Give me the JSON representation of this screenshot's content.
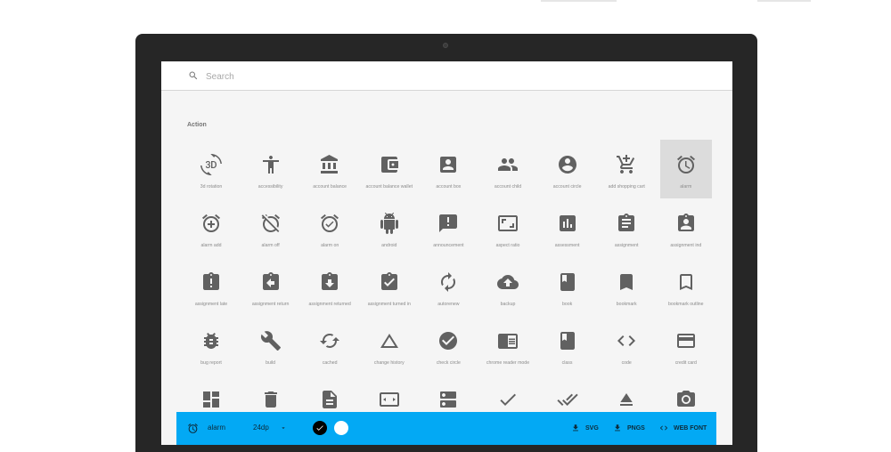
{
  "search": {
    "placeholder": "Search"
  },
  "section": {
    "title": "Action"
  },
  "icons": [
    {
      "label": "3d rotation",
      "icon": "3d-rotation-icon"
    },
    {
      "label": "accessibility",
      "icon": "accessibility-icon"
    },
    {
      "label": "account balance",
      "icon": "account-balance-icon"
    },
    {
      "label": "account balance wallet",
      "icon": "account-balance-wallet-icon"
    },
    {
      "label": "account box",
      "icon": "account-box-icon"
    },
    {
      "label": "account child",
      "icon": "account-child-icon"
    },
    {
      "label": "account circle",
      "icon": "account-circle-icon"
    },
    {
      "label": "add shopping cart",
      "icon": "add-shopping-cart-icon"
    },
    {
      "label": "alarm",
      "icon": "alarm-icon",
      "selected": true
    },
    {
      "label": "alarm add",
      "icon": "alarm-add-icon"
    },
    {
      "label": "alarm off",
      "icon": "alarm-off-icon"
    },
    {
      "label": "alarm on",
      "icon": "alarm-on-icon"
    },
    {
      "label": "android",
      "icon": "android-icon"
    },
    {
      "label": "announcement",
      "icon": "announcement-icon"
    },
    {
      "label": "aspect ratio",
      "icon": "aspect-ratio-icon"
    },
    {
      "label": "assessment",
      "icon": "assessment-icon"
    },
    {
      "label": "assignment",
      "icon": "assignment-icon"
    },
    {
      "label": "assignment ind",
      "icon": "assignment-ind-icon"
    },
    {
      "label": "assignment late",
      "icon": "assignment-late-icon"
    },
    {
      "label": "assignment return",
      "icon": "assignment-return-icon"
    },
    {
      "label": "assignment returned",
      "icon": "assignment-returned-icon"
    },
    {
      "label": "assignment turned in",
      "icon": "assignment-turned-in-icon"
    },
    {
      "label": "autorenew",
      "icon": "autorenew-icon"
    },
    {
      "label": "backup",
      "icon": "backup-icon"
    },
    {
      "label": "book",
      "icon": "book-icon"
    },
    {
      "label": "bookmark",
      "icon": "bookmark-icon"
    },
    {
      "label": "bookmark outline",
      "icon": "bookmark-outline-icon"
    },
    {
      "label": "bug report",
      "icon": "bug-report-icon"
    },
    {
      "label": "build",
      "icon": "build-icon"
    },
    {
      "label": "cached",
      "icon": "cached-icon"
    },
    {
      "label": "change history",
      "icon": "change-history-icon"
    },
    {
      "label": "check circle",
      "icon": "check-circle-icon"
    },
    {
      "label": "chrome reader mode",
      "icon": "chrome-reader-mode-icon"
    },
    {
      "label": "class",
      "icon": "class-icon"
    },
    {
      "label": "code",
      "icon": "code-icon"
    },
    {
      "label": "credit card",
      "icon": "credit-card-icon"
    },
    {
      "label": "",
      "icon": "dashboard-icon"
    },
    {
      "label": "",
      "icon": "delete-icon"
    },
    {
      "label": "",
      "icon": "description-icon"
    },
    {
      "label": "",
      "icon": "dns-icon"
    },
    {
      "label": "",
      "icon": "dns-list-icon"
    },
    {
      "label": "",
      "icon": "done-icon"
    },
    {
      "label": "",
      "icon": "done-all-icon"
    },
    {
      "label": "",
      "icon": "eject-icon"
    },
    {
      "label": "",
      "icon": "camera-icon"
    }
  ],
  "bottom": {
    "selected_name": "alarm",
    "size": "24dp",
    "svg_label": "SVG",
    "png_label": "PNGS",
    "font_label": "WEB FONT"
  },
  "colors": {
    "accent": "#03a9f4",
    "icon": "#616161",
    "selected_bg": "#dcdcdc"
  }
}
